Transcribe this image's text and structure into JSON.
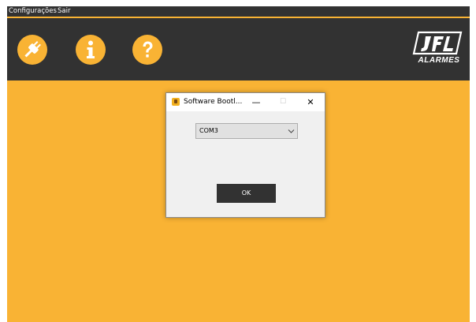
{
  "menu": {
    "configuracoes": "Configurações",
    "sair": "Sair"
  },
  "toolbar": {
    "buttons": [
      {
        "icon": "plug-icon"
      },
      {
        "icon": "info-icon"
      },
      {
        "icon": "help-question-icon"
      }
    ]
  },
  "logo": {
    "brand_text": "ALARMES"
  },
  "dialog": {
    "title": "Software Bootl...",
    "minimize_glyph": "—",
    "maximize_glyph": "☐",
    "close_glyph": "✕",
    "com_port": "COM3",
    "ok_label": "OK"
  },
  "colors": {
    "accent": "#f9b334",
    "dark": "#323232",
    "dialog_bg": "#f0f0f0"
  }
}
